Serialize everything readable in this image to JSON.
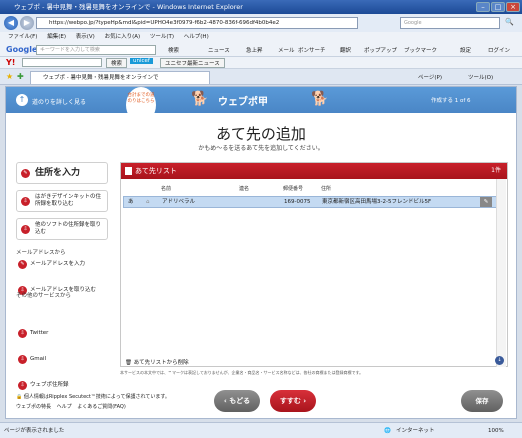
{
  "browser": {
    "title": "ウェブポ - 暑中見舞・残暑見舞をオンラインで - Windows Internet Explorer",
    "url": "https://webpo.jp/?typeHp&mdl&pid=UPHO4e3f0979-f6b2-4870-836f-696df4b0b4e2",
    "search_placeholder": "Google",
    "menu": [
      "ファイル(F)",
      "編集(E)",
      "表示(V)",
      "お気に入り(A)",
      "ツール(T)",
      "ヘルプ(H)"
    ],
    "google_placeholder": "キーワードを入力して検索",
    "toolbar_items": [
      "検索",
      "ニュース",
      "急上昇",
      "メール",
      "ボンサーチ",
      "翻訳",
      "ポップアップ",
      "ブックマーク",
      "設定",
      "ログイン"
    ],
    "yahoo_search": "検索",
    "unicef_label": "unicef",
    "unicef_news": "ユニセフ最新ニュース",
    "tab_label": "ウェブポ - 暑中見舞・残暑見舞をオンラインで",
    "tab_tools": [
      "ページ(P)",
      "ツール(O)"
    ],
    "status_left": "ページが表示されました",
    "status_zone": "インターネット",
    "zoom": "100%"
  },
  "header": {
    "guide": "道のりを詳しく見る",
    "bubble": "合計までの道のりはこちら",
    "logo": "ウェブポ甲",
    "step": "作成する 1 of 6"
  },
  "page": {
    "title": "あて先の追加",
    "subtitle": "かもめ〜るを送るあて先を追加してください。"
  },
  "sidebar": {
    "main": "住所を入力",
    "items": [
      "はがきデザインキットの住所録を取り込む",
      "他のソフトの住所録を取り込む"
    ],
    "mail_head": "メールアドレスから",
    "mail_links": [
      "メールアドレスを入力",
      "メールアドレスを取り込む"
    ],
    "other_head": "その他のサービスから",
    "other_links": [
      "Twitter",
      "Gmail",
      "ウェブポ住所録"
    ]
  },
  "list": {
    "title": "あて先リスト",
    "count": "1件",
    "columns": [
      "名前",
      "連名",
      "郵便番号",
      "住所"
    ],
    "rows": [
      {
        "index": "あ",
        "name": "アドリベラル",
        "joint": "",
        "zip": "169-0075",
        "address": "東京都新宿区高田馬場3-2-5フレンドビル5F"
      }
    ],
    "delete_label": "あて先リストから削除"
  },
  "notice": "本サービスの本文中では、™マークは表記しておりませんが、企業名・商品名・サービス名称などは、各社の商標または登録商標です。",
  "buttons": {
    "back": "もどる",
    "next": "すすむ",
    "save": "保存"
  },
  "footer": {
    "security": "個人情報はRipplex Secutect™技術によって保護されています。",
    "links": [
      "ウェブポの特長",
      "ヘルプ",
      "よくあるご質問(FAQ)"
    ]
  }
}
